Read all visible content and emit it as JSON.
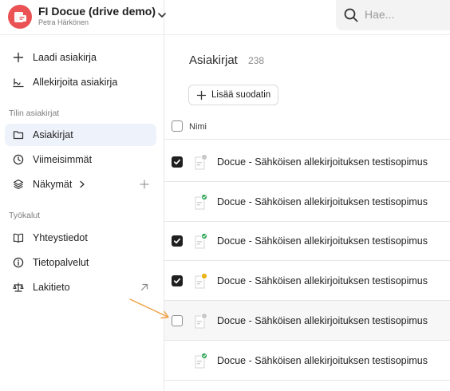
{
  "organization": {
    "name": "FI Docue (drive demo)",
    "user": "Petra Härkönen"
  },
  "search": {
    "placeholder": "Hae..."
  },
  "sidebar": {
    "actions": [
      {
        "label": "Laadi asiakirja",
        "icon": "plus-icon"
      },
      {
        "label": "Allekirjoita asiakirja",
        "icon": "signature-icon"
      }
    ],
    "account_section": "Tilin asiakirjat",
    "account_items": [
      {
        "label": "Asiakirjat",
        "icon": "folder-icon",
        "active": true
      },
      {
        "label": "Viimeisimmät",
        "icon": "clock-icon"
      },
      {
        "label": "Näkymät",
        "icon": "layers-icon"
      }
    ],
    "tools_section": "Työkalut",
    "tools_items": [
      {
        "label": "Yhteystiedot",
        "icon": "book-icon"
      },
      {
        "label": "Tietopalvelut",
        "icon": "info-icon"
      },
      {
        "label": "Lakitieto",
        "icon": "scales-icon"
      }
    ]
  },
  "main": {
    "title": "Asiakirjat",
    "count": "238",
    "add_filter": "Lisää suodatin",
    "column_name": "Nimi",
    "rows": [
      {
        "title": "Docue - Sähköisen allekirjoituksen testisopimus",
        "checked": true,
        "status": "pending"
      },
      {
        "title": "Docue - Sähköisen allekirjoituksen testisopimus",
        "checked": false,
        "status": "signed"
      },
      {
        "title": "Docue - Sähköisen allekirjoituksen testisopimus",
        "checked": true,
        "status": "signed"
      },
      {
        "title": "Docue - Sähköisen allekirjoituksen testisopimus",
        "checked": true,
        "status": "awaiting"
      },
      {
        "title": "Docue - Sähköisen allekirjoituksen testisopimus",
        "checked": false,
        "status": "pending"
      },
      {
        "title": "Docue - Sähköisen allekirjoituksen testisopimus",
        "checked": false,
        "status": "signed"
      }
    ]
  },
  "colors": {
    "avatar": "#ea5253",
    "active_nav": "#eef3fb",
    "signed": "#2fa65a",
    "awaiting": "#e9b31c",
    "pending": "#c9c9c9",
    "annotation_arrow": "#f0a043"
  }
}
